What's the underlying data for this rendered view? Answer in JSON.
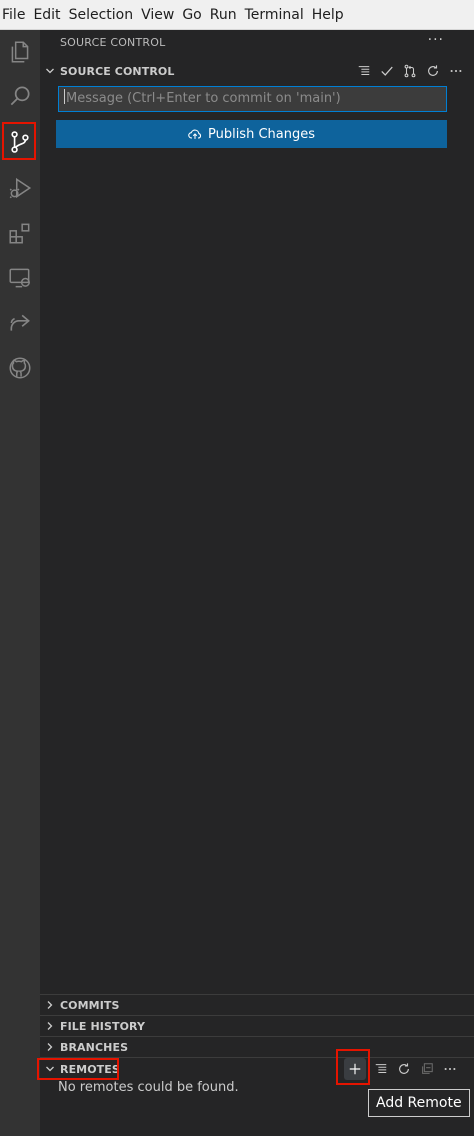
{
  "menubar": {
    "items": [
      "File",
      "Edit",
      "Selection",
      "View",
      "Go",
      "Run",
      "Terminal",
      "Help"
    ]
  },
  "activitybar": {
    "items": [
      {
        "icon": "files-icon",
        "active": false
      },
      {
        "icon": "search-icon",
        "active": false
      },
      {
        "icon": "source-control-icon",
        "active": true
      },
      {
        "icon": "run-debug-icon",
        "active": false
      },
      {
        "icon": "extensions-icon",
        "active": false
      },
      {
        "icon": "remote-explorer-icon",
        "active": false
      },
      {
        "icon": "live-share-icon",
        "active": false
      },
      {
        "icon": "github-icon",
        "active": false
      }
    ]
  },
  "sidebar": {
    "view_title": "SOURCE CONTROL",
    "more": "···",
    "source_control": {
      "title": "SOURCE CONTROL",
      "actions": [
        "view-as-tree-icon",
        "commit-check-icon",
        "pull-request-icon",
        "refresh-icon",
        "more-icon"
      ],
      "commit_placeholder": "Message (Ctrl+Enter to commit on 'main')",
      "publish_label": "Publish Changes"
    },
    "sections": {
      "commits": "COMMITS",
      "file_history": "FILE HISTORY",
      "branches": "BRANCHES",
      "remotes": "REMOTES"
    },
    "remotes_empty": "No remotes could be found.",
    "remotes_actions": [
      "add-icon",
      "view-as-list-icon",
      "refresh-icon",
      "collapse-all-icon",
      "more-icon"
    ],
    "tooltip": "Add Remote"
  },
  "colors": {
    "accent": "#0e639c",
    "focus_border": "#007fd4",
    "highlight": "#e51400"
  }
}
